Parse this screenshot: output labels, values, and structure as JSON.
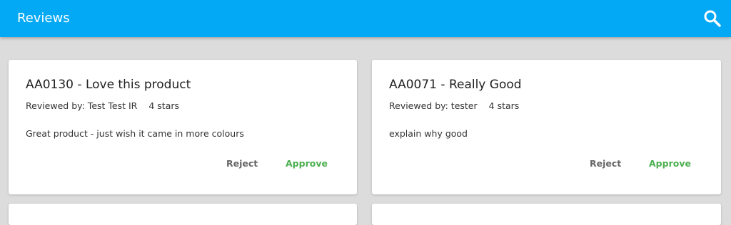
{
  "header": {
    "title": "Reviews",
    "search_icon": "search-icon",
    "bg_color": "#03a9f4"
  },
  "reviews": [
    {
      "title": "AA0130 - Love this product",
      "reviewed_by": "Reviewed by: Test Test IR",
      "stars": "4 stars",
      "body": "Great product - just wish it came in more colours",
      "reject_label": "Reject",
      "approve_label": "Approve"
    },
    {
      "title": "AA0071 - Really Good",
      "reviewed_by": "Reviewed by: tester",
      "stars": "4 stars",
      "body": "explain why good",
      "reject_label": "Reject",
      "approve_label": "Approve"
    }
  ],
  "colors": {
    "approve": "#4caf50",
    "reject": "#666666",
    "background": "#dcdcdc"
  }
}
